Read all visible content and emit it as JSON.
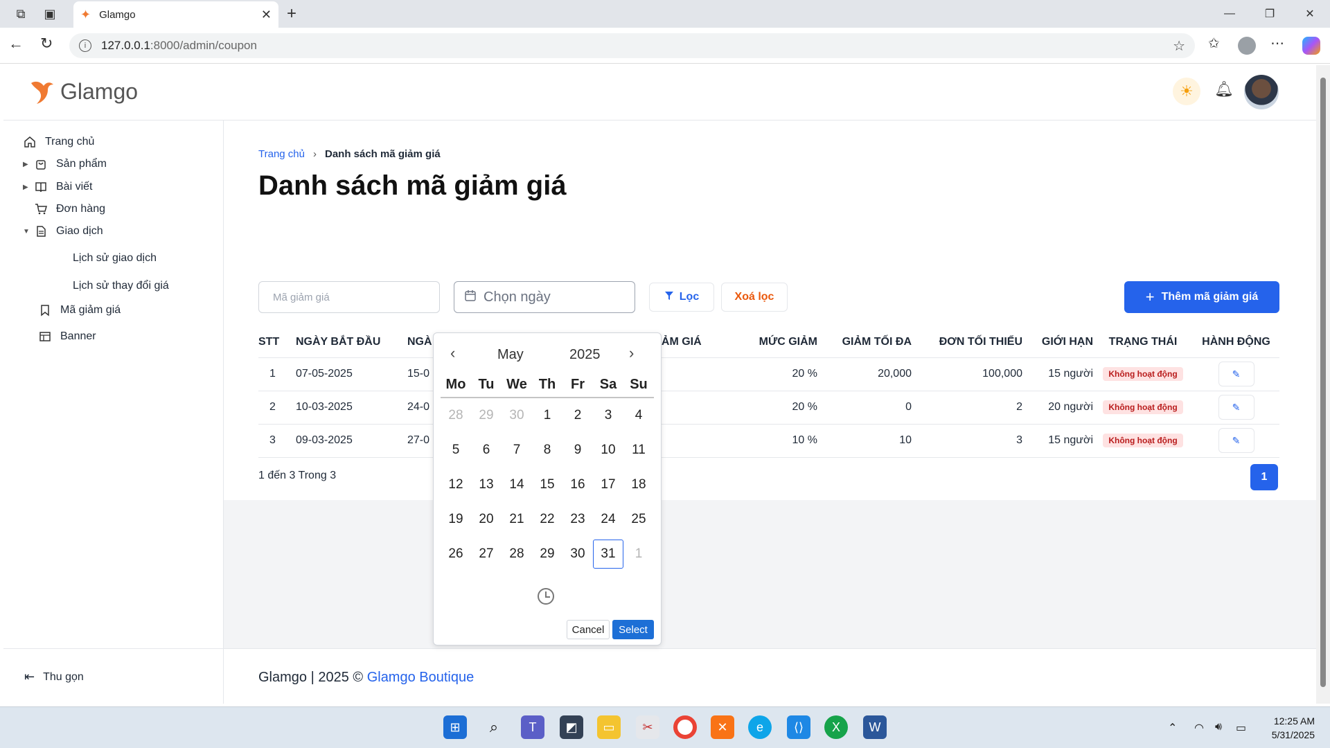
{
  "browser": {
    "tab_title": "Glamgo",
    "url_host": "127.0.0.1",
    "url_rest": ":8000/admin/coupon"
  },
  "header": {
    "brand": "Glamgo"
  },
  "sidebar": {
    "items": [
      {
        "label": "Trang chủ",
        "icon": "home-icon"
      },
      {
        "label": "Sản phẩm",
        "icon": "bag-icon"
      },
      {
        "label": "Bài viết",
        "icon": "book-icon"
      },
      {
        "label": "Đơn hàng",
        "icon": "cart-icon"
      },
      {
        "label": "Giao dịch",
        "icon": "document-icon"
      },
      {
        "label": "Lịch sử giao dịch"
      },
      {
        "label": "Lịch sử thay đổi giá"
      },
      {
        "label": "Mã giảm giá",
        "icon": "bookmark-icon"
      },
      {
        "label": "Banner",
        "icon": "layout-icon"
      }
    ],
    "collapse_label": "Thu gọn"
  },
  "breadcrumb": {
    "home": "Trang chủ",
    "current": "Danh sách mã giảm giá"
  },
  "page_title": "Danh sách mã giảm giá",
  "filters": {
    "code_placeholder": "Mã giảm giá",
    "date_placeholder": "Chọn ngày",
    "filter_label": "Lọc",
    "clear_label": "Xoá lọc",
    "add_label": "Thêm mã giảm giá"
  },
  "table": {
    "headers": [
      "STT",
      "NGÀY BẮT ĐẦU",
      "NGÀ",
      "GIẢM GIÁ",
      "MỨC GIẢM",
      "GIẢM TỐI ĐA",
      "ĐƠN TỐI THIỂU",
      "GIỚI HẠN",
      "TRẠNG THÁI",
      "HÀNH ĐỘNG"
    ],
    "rows": [
      {
        "stt": "1",
        "start": "07-05-2025",
        "end": "15-0",
        "type": "%",
        "amount": "20 %",
        "max": "20,000",
        "min": "100,000",
        "limit": "15 người",
        "status": "Không hoạt động"
      },
      {
        "stt": "2",
        "start": "10-03-2025",
        "end": "24-0",
        "type": "%",
        "amount": "20 %",
        "max": "0",
        "min": "2",
        "limit": "20 người",
        "status": "Không hoạt động"
      },
      {
        "stt": "3",
        "start": "09-03-2025",
        "end": "27-0",
        "type": "%",
        "amount": "10 %",
        "max": "10",
        "min": "3",
        "limit": "15 người",
        "status": "Không hoạt động"
      }
    ]
  },
  "pagination": {
    "summary": "1 đến 3 Trong 3",
    "current_page": "1"
  },
  "footer": {
    "text": "Glamgo | 2025 © ",
    "link": "Glamgo Boutique"
  },
  "datepicker": {
    "month": "May",
    "year": "2025",
    "weekdays": [
      "Mo",
      "Tu",
      "We",
      "Th",
      "Fr",
      "Sa",
      "Su"
    ],
    "days": [
      {
        "d": "28",
        "muted": true
      },
      {
        "d": "29",
        "muted": true
      },
      {
        "d": "30",
        "muted": true
      },
      {
        "d": "1"
      },
      {
        "d": "2"
      },
      {
        "d": "3"
      },
      {
        "d": "4"
      },
      {
        "d": "5"
      },
      {
        "d": "6"
      },
      {
        "d": "7"
      },
      {
        "d": "8"
      },
      {
        "d": "9"
      },
      {
        "d": "10"
      },
      {
        "d": "11"
      },
      {
        "d": "12"
      },
      {
        "d": "13"
      },
      {
        "d": "14"
      },
      {
        "d": "15"
      },
      {
        "d": "16"
      },
      {
        "d": "17"
      },
      {
        "d": "18"
      },
      {
        "d": "19"
      },
      {
        "d": "20"
      },
      {
        "d": "21"
      },
      {
        "d": "22"
      },
      {
        "d": "23"
      },
      {
        "d": "24"
      },
      {
        "d": "25"
      },
      {
        "d": "26"
      },
      {
        "d": "27"
      },
      {
        "d": "28"
      },
      {
        "d": "29"
      },
      {
        "d": "30"
      },
      {
        "d": "31",
        "selected": true
      },
      {
        "d": "1",
        "muted": true
      }
    ],
    "cancel_label": "Cancel",
    "select_label": "Select"
  },
  "taskbar": {
    "time": "12:25 AM",
    "date": "5/31/2025"
  },
  "colors": {
    "primary": "#2563eb",
    "accent_orange": "#ea580c",
    "badge_bg": "#fee2e2",
    "badge_text": "#b91c1c"
  }
}
